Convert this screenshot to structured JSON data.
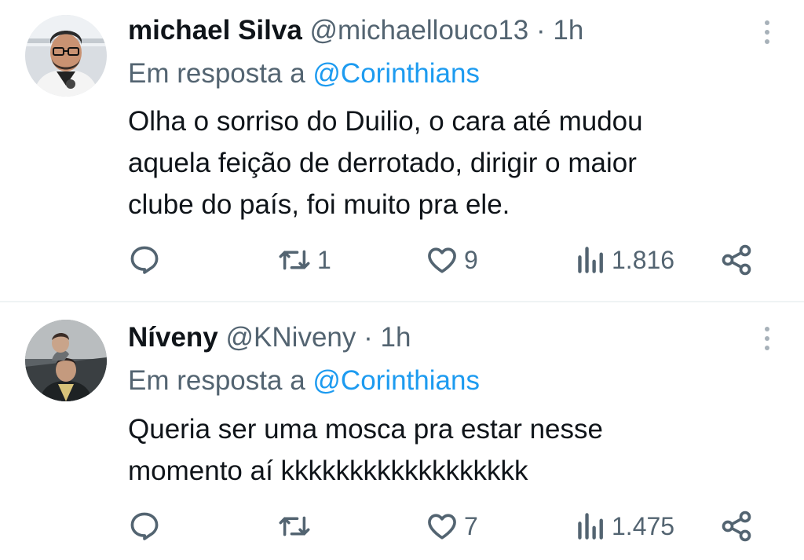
{
  "tweets": [
    {
      "name": "michael Silva",
      "handle": "@michaellouco13",
      "separator": "·",
      "time": "1h",
      "reply_prefix": "Em resposta a",
      "reply_mention": "@Corinthians",
      "text_lines": [
        "Olha o sorriso do Duilio, o cara até mudou",
        "aquela feição de derrotado, dirigir o maior",
        "clube do país, foi muito pra ele."
      ],
      "actions": {
        "replies": "",
        "retweets": "1",
        "likes": "9",
        "views": "1.816"
      }
    },
    {
      "name": "Níveny",
      "handle": "@KNiveny",
      "separator": "·",
      "time": "1h",
      "reply_prefix": "Em resposta a",
      "reply_mention": "@Corinthians",
      "text_lines": [
        "Queria ser uma mosca pra estar nesse",
        "momento aí kkkkkkkkkkkkkkkkkk"
      ],
      "actions": {
        "replies": "",
        "retweets": "",
        "likes": "7",
        "views": "1.475"
      }
    }
  ],
  "icons": {
    "reply": "reply-icon",
    "retweet": "retweet-icon",
    "like": "heart-icon",
    "views": "views-icon",
    "share": "share-icon",
    "more": "more-icon"
  },
  "colors": {
    "text": "#0f1419",
    "secondary": "#536471",
    "mention": "#1d9bf0",
    "divider": "#eff3f4"
  }
}
